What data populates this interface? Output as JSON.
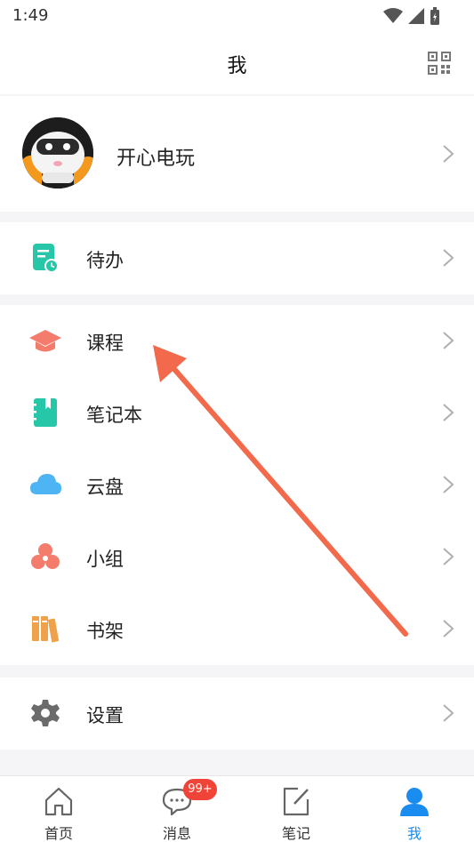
{
  "status": {
    "time": "1:49"
  },
  "header": {
    "title": "我"
  },
  "profile": {
    "name": "开心电玩"
  },
  "menu": {
    "todo": "待办",
    "courses": "课程",
    "notebook": "笔记本",
    "cloud": "云盘",
    "group": "小组",
    "bookshelf": "书架",
    "settings": "设置"
  },
  "tabs": [
    {
      "label": "首页"
    },
    {
      "label": "消息",
      "badge": "99+"
    },
    {
      "label": "笔记"
    },
    {
      "label": "我"
    }
  ],
  "colors": {
    "accent": "#1a8cf0",
    "teal": "#26c6a8",
    "salmon": "#f47c6c",
    "sky": "#4fb4f3",
    "orange": "#f0a24a",
    "arrow": "#f26a4b"
  }
}
